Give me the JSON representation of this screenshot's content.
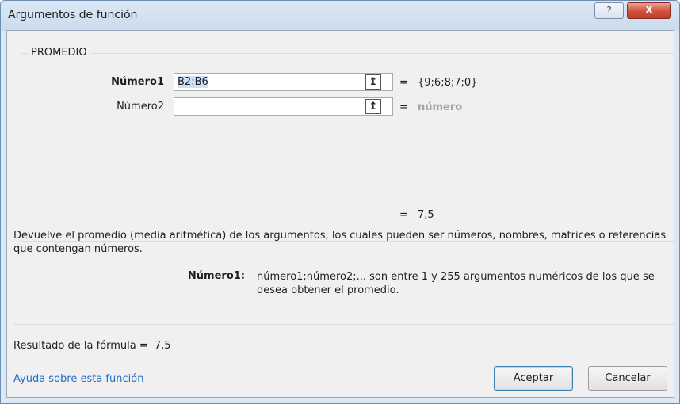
{
  "window": {
    "title": "Argumentos de función",
    "help_label": "?",
    "close_label": "X"
  },
  "group": {
    "legend": "PROMEDIO"
  },
  "args": [
    {
      "label": "Número1",
      "value": "B2:B6",
      "ref_icon": "↥",
      "equals": "=",
      "result": "{9;6;8;7;0}"
    },
    {
      "label": "Número2",
      "value": "",
      "ref_icon": "↥",
      "equals": "=",
      "result": "número"
    }
  ],
  "function_result": {
    "equals": "=",
    "value": "7,5"
  },
  "description": "Devuelve el promedio (media aritmética) de los argumentos, los cuales pueden ser números, nombres, matrices o referencias que contengan números.",
  "argument_help": {
    "name": "Número1:",
    "text": "número1;número2;... son entre 1 y 255 argumentos numéricos de los que se desea obtener el promedio."
  },
  "formula_result": {
    "label": "Resultado de la fórmula =",
    "value": "7,5"
  },
  "help_link": "Ayuda sobre esta función",
  "buttons": {
    "ok": "Aceptar",
    "cancel": "Cancelar"
  }
}
